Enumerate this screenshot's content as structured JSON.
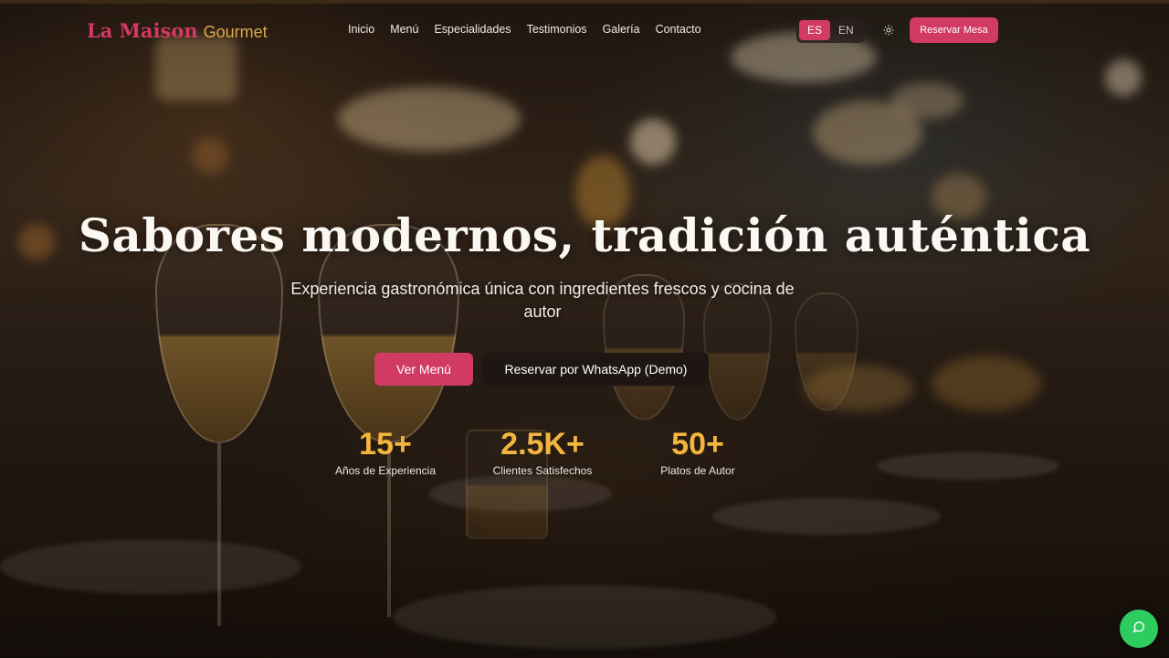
{
  "brand": {
    "name_part1": "La Maison",
    "name_part2": "Gourmet"
  },
  "nav": {
    "items": [
      {
        "label": "Inicio"
      },
      {
        "label": "Menú"
      },
      {
        "label": "Especialidades"
      },
      {
        "label": "Testimonios"
      },
      {
        "label": "Galería"
      },
      {
        "label": "Contacto"
      }
    ],
    "languages": [
      {
        "label": "ES",
        "active": true
      },
      {
        "label": "EN",
        "active": false
      }
    ],
    "theme_icon": "sun-icon",
    "reserve_label": "Reservar Mesa"
  },
  "hero": {
    "title": "Sabores modernos, tradición auténtica",
    "subtitle": "Experiencia gastronómica única con ingredientes frescos y cocina de autor",
    "primary_cta": "Ver Menú",
    "secondary_cta": "Reservar por WhatsApp (Demo)",
    "stats": [
      {
        "value": "15+",
        "label": "Años de Experiencia"
      },
      {
        "value": "2.5K+",
        "label": "Clientes Satisfechos"
      },
      {
        "value": "50+",
        "label": "Platos de Autor"
      }
    ]
  },
  "chat_button": {
    "icon": "chat-bubble-icon"
  },
  "colors": {
    "accent": "#d03a63",
    "gold": "#d9a94a",
    "stat_number": "#f3b53e",
    "chat_green": "#2ecc5f",
    "dark_button": "#1d1613"
  }
}
